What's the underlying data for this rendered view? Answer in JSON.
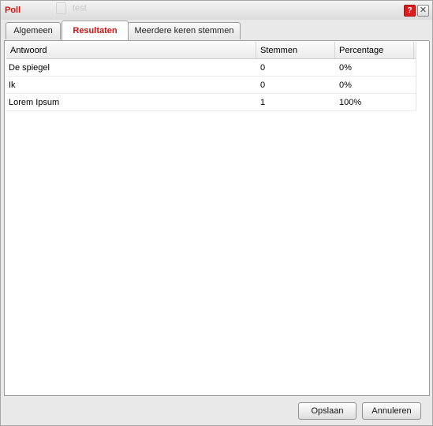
{
  "window": {
    "title": "Poll",
    "help_label": "?",
    "close_label": "✕",
    "background_text": "test"
  },
  "tabs": [
    {
      "label": "Algemeen",
      "active": false
    },
    {
      "label": "Resultaten",
      "active": true
    },
    {
      "label": "Meerdere keren stemmen",
      "active": false
    }
  ],
  "table": {
    "columns": [
      "Antwoord",
      "Stemmen",
      "Percentage"
    ],
    "rows": [
      {
        "answer": "De spiegel",
        "votes": "0",
        "percentage": "0%"
      },
      {
        "answer": "Ik",
        "votes": "0",
        "percentage": "0%"
      },
      {
        "answer": "Lorem Ipsum",
        "votes": "1",
        "percentage": "100%"
      }
    ]
  },
  "buttons": {
    "save": "Opslaan",
    "cancel": "Annuleren"
  },
  "colors": {
    "accent": "#d41111",
    "help_button": "#d81e1e"
  }
}
